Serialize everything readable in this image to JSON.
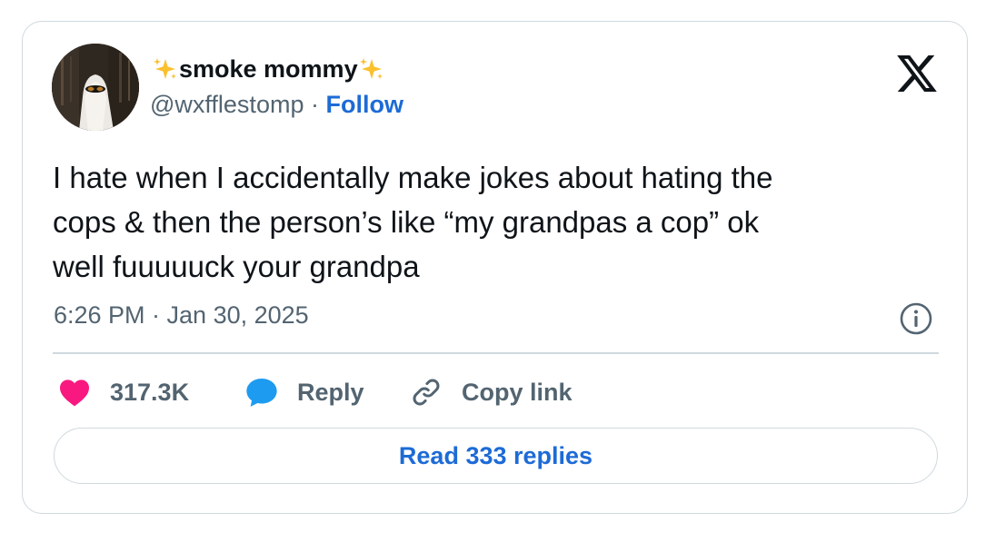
{
  "tweet": {
    "author": {
      "display_name": "smoke mommy",
      "name_emoji": "sparkles-icon",
      "handle": "@wxfflestomp",
      "separator": "·",
      "follow_label": "Follow"
    },
    "platform_icon": "x-logo-icon",
    "text": "I hate when I accidentally make jokes about hating the\ncops & then the person’s like “my grandpas a cop” ok\nwell fuuuuuck your grandpa",
    "timestamp": "6:26 PM · Jan 30, 2025",
    "info_icon": "info-icon",
    "actions": {
      "likes": "317.3K",
      "reply_label": "Reply",
      "copy_link_label": "Copy link"
    },
    "read_replies_label": "Read 333 replies"
  },
  "colors": {
    "text_primary": "#0f1419",
    "text_secondary": "#536471",
    "link_blue": "#1d6bd6",
    "like_pink": "#f91880",
    "reply_blue": "#1d9bf0",
    "border": "#cfd9de",
    "sparkle_gold": "#fbc02d"
  }
}
